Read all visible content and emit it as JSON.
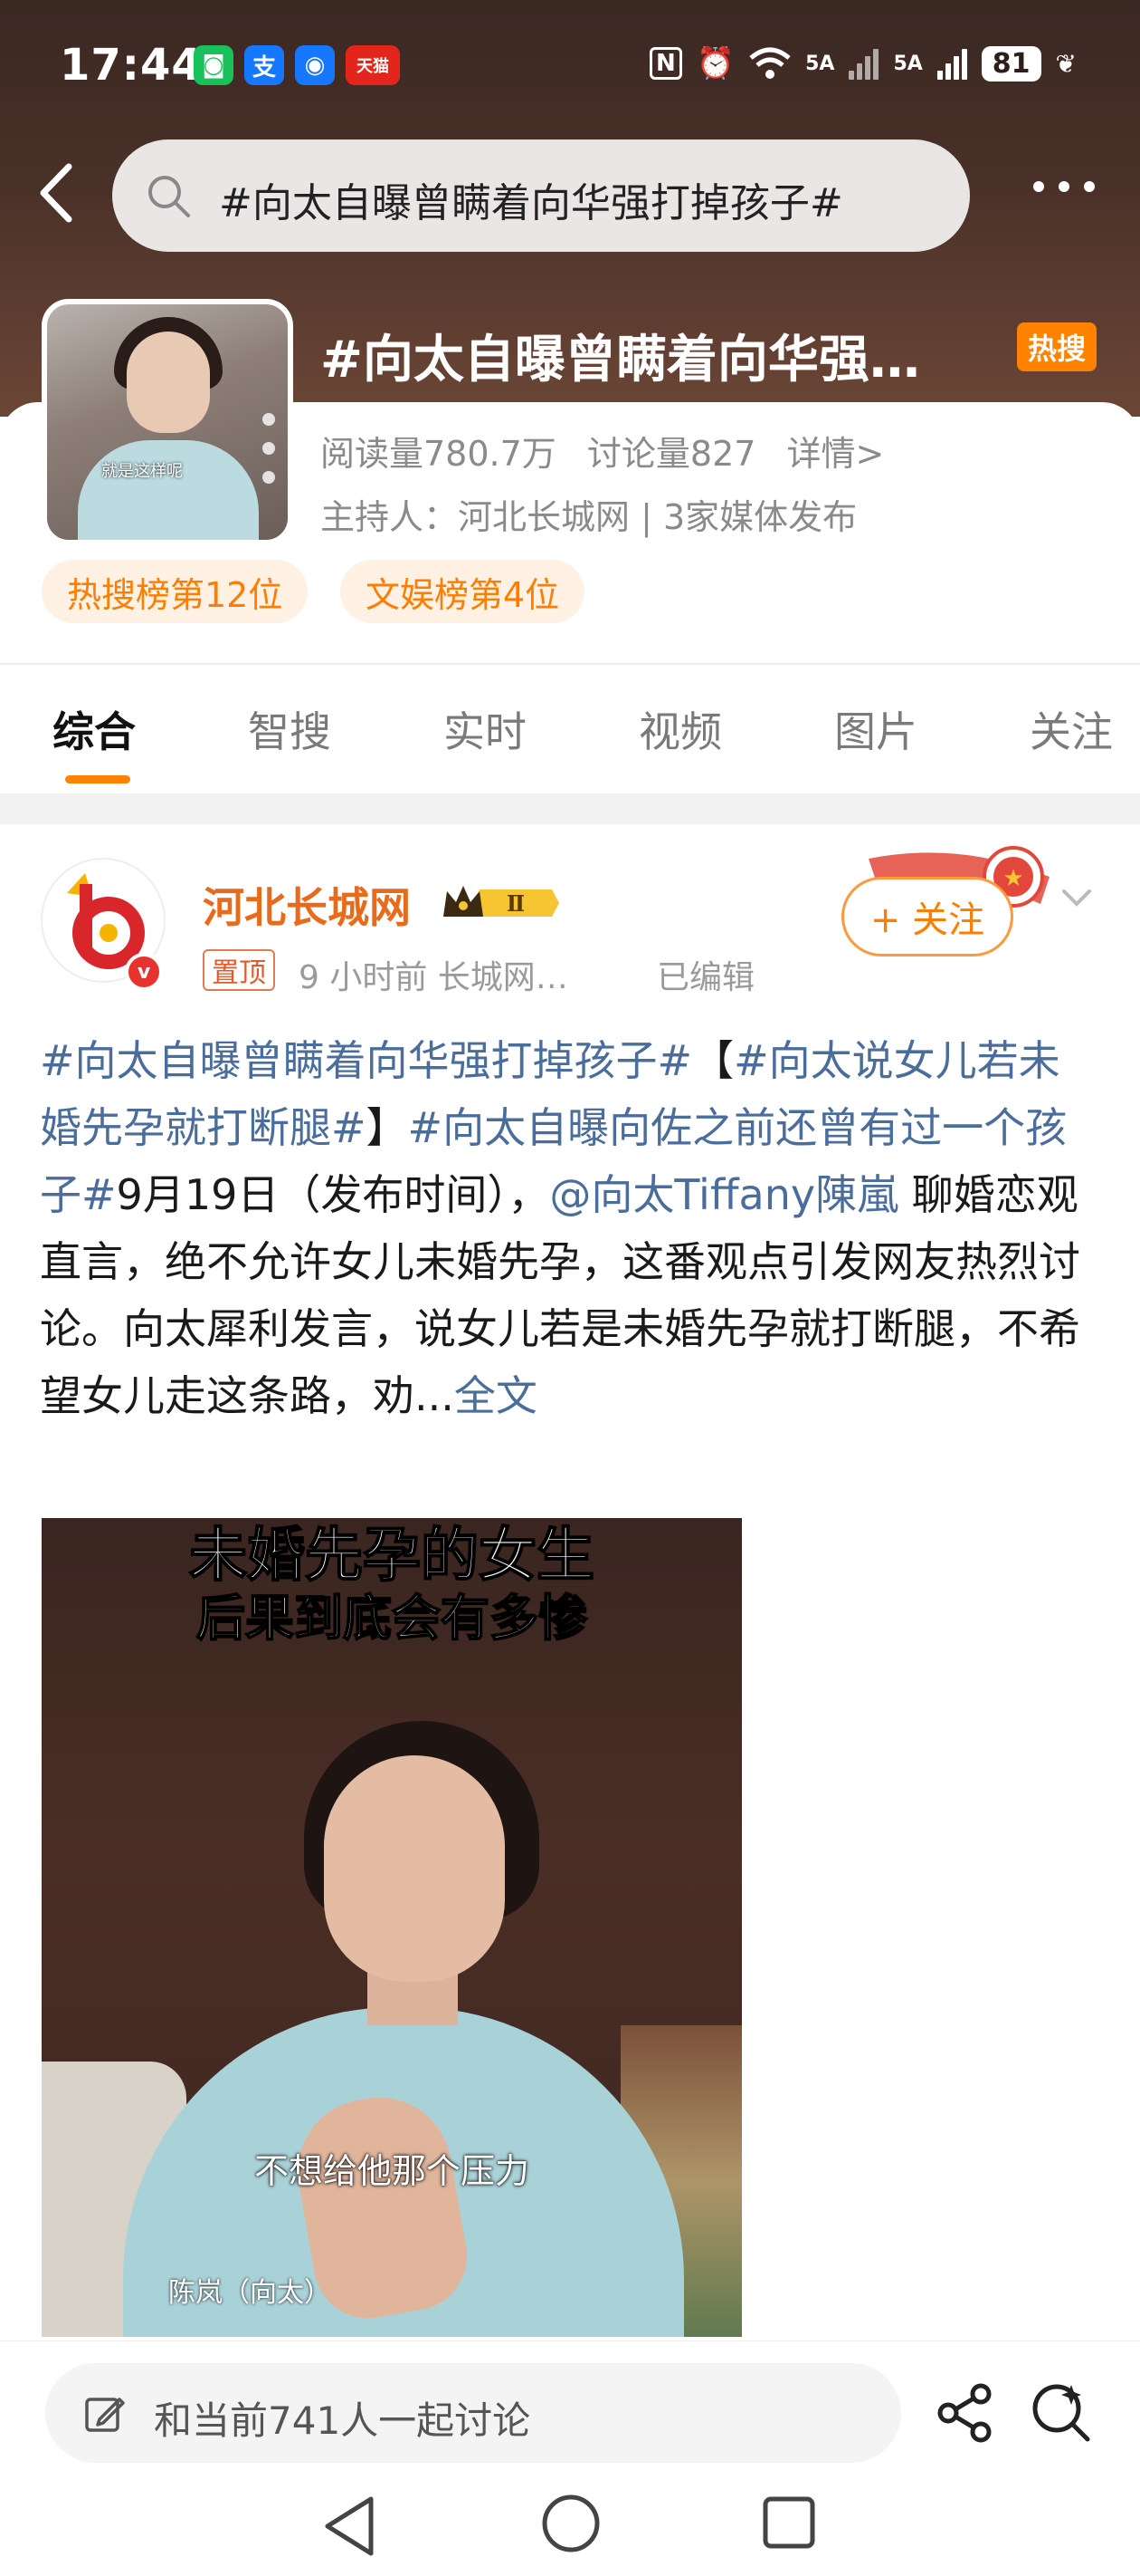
{
  "status_bar": {
    "time": "17:44",
    "app_icons": [
      {
        "name": "miniapp-icon",
        "glyph": "◙",
        "color": "#19c15a"
      },
      {
        "name": "alipay-icon",
        "glyph": "支",
        "color": "#1677ff"
      },
      {
        "name": "message-app-icon",
        "glyph": "◉",
        "color": "#1677ff"
      },
      {
        "name": "tmall-icon",
        "glyph": "天猫",
        "color": "#e4251b"
      }
    ],
    "nfc": "N",
    "sim1": "5A",
    "sim2": "5A",
    "battery": "81"
  },
  "search": {
    "query": "#向太自曝曾瞒着向华强打掉孩子#"
  },
  "topic": {
    "title": "#向太自曝曾瞒着向华强…",
    "hot_badge": "热搜",
    "read_count": "阅读量780.7万",
    "discuss_count": "讨论量827",
    "details": "详情>",
    "host": "主持人：河北长城网 | 3家媒体发布",
    "cover_caption": "就是这样呢",
    "ranks": [
      "热搜榜第12位",
      "文娱榜第4位"
    ]
  },
  "tabs": [
    "综合",
    "智搜",
    "实时",
    "视频",
    "图片",
    "关注"
  ],
  "active_tab": "综合",
  "post": {
    "author": "河北长城网",
    "level_badge": "Ⅱ",
    "pinned": "置顶",
    "time_source": "9 小时前  长城网…",
    "edited": "已编辑",
    "follow_label": "+ 关注",
    "text_parts": [
      {
        "t": "#向太自曝曾瞒着向华强打掉孩子#",
        "tag": true
      },
      {
        "t": "【",
        "tag": false
      },
      {
        "t": "#向太说女儿若未婚先孕就打断腿#",
        "tag": true
      },
      {
        "t": "】",
        "tag": false
      },
      {
        "t": "#向太自曝向佐之前还曾有过一个孩子#",
        "tag": true
      },
      {
        "t": "9月19日（发布时间），",
        "tag": false
      },
      {
        "t": "@向太Tiffany陳嵐",
        "tag": true
      },
      {
        "t": " 聊婚恋观直言，绝不允许女儿未婚先孕，这番观点引发网友热烈讨论。向太犀利发言，说女儿若是未婚先孕就打断腿，不希望女儿走这条路，劝...",
        "tag": false
      }
    ],
    "read_more": "全文",
    "video": {
      "caption_line1": "未婚先孕的女生",
      "caption_line2": "后果到底会有多惨",
      "subtitle": "不想给他那个压力",
      "name_tag": "陈岚（向太）"
    }
  },
  "bottom": {
    "comment_placeholder": "和当前741人一起讨论"
  },
  "colors": {
    "accent": "#ff8200",
    "link": "#4a6d9c",
    "author": "#e86a1b"
  }
}
